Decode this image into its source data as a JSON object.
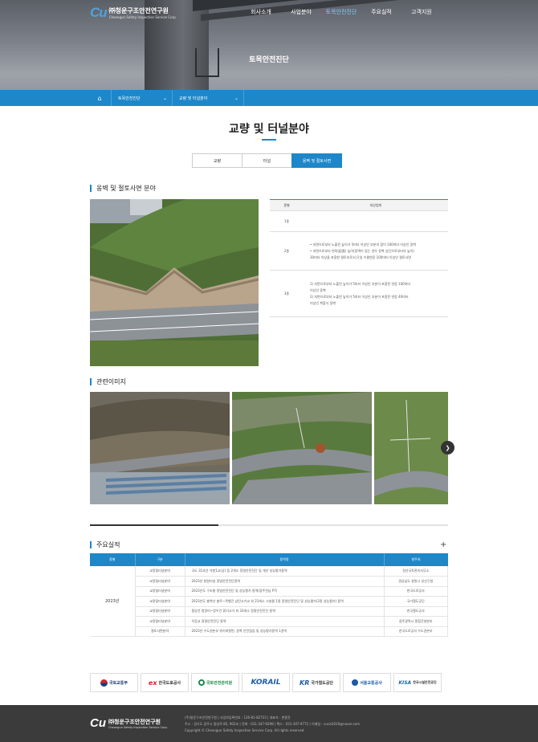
{
  "header": {
    "logo_mark": "Cu",
    "logo_name": "㈜청운구조안전연구원",
    "logo_eng": "Cheongun Safety Inspection Service Corp.",
    "nav": [
      "회사소개",
      "사업분야",
      "토목안전진단",
      "주요실적",
      "고객지원"
    ],
    "active_nav": 2
  },
  "hero": {
    "title": "토목안전진단"
  },
  "breadcrumb": {
    "level1": "토목안전진단",
    "level2": "교량 및 터널분야"
  },
  "page_title": "교량 및 터널분야",
  "tabs": [
    {
      "label": "교량",
      "active": false
    },
    {
      "label": "터널",
      "active": false
    },
    {
      "label": "옹벽 및 절토사면",
      "active": true
    }
  ],
  "section1": {
    "heading": "옹벽 및 절토사면 분야",
    "table": {
      "headers": [
        "종별",
        "대상범위"
      ],
      "rows": [
        {
          "grade": "1종",
          "lines": []
        },
        {
          "grade": "2종",
          "lines": [
            "• 지면으로부터 노출된 높이가 5미터 이상인 부분의 합이 100미터 이상인 옹벽",
            "• 지면으로부터 연직(鉛直) 높이(옹벽이 있는 경우 옹벽 상단으로부터의 높이)",
            "  30미터 이상을 포함한 절토부로서 단일 수평연장 100미터 이상인 절토사면"
          ]
        },
        {
          "grade": "3종",
          "lines": [
            "1) 지면으로부터 노출된 높이가 5미터 이상인 부분이 포함된 연장 100미터",
            "   이상인 옹벽",
            "2) 지면으로부터 노출된 높이가 5미터 이상인 부분이 포함된 연장 40미터",
            "   이상인 복합식 옹벽"
          ]
        }
      ]
    }
  },
  "section2": {
    "heading": "관련이미지"
  },
  "section3": {
    "heading": "주요실적",
    "plus": "+",
    "headers": [
      "종별",
      "구분",
      "용역명",
      "발주처"
    ],
    "year": "2023년",
    "rows": [
      {
        "type": "교량및터널분야",
        "name": "국도 31호선 석항1교(상) 등 2개소 정밀안전진단 및 개선 성능평가용역",
        "client": "정선국토관리사무소"
      },
      {
        "type": "교량및터널분야",
        "name": "2023년 창원터널 정밀안전진단용역",
        "client": "경상남도 창원시 성산구청"
      },
      {
        "type": "교량및터널분야",
        "name": "2023년도 구조물 정밀안전진단 및 성능평가 용역(광주전남 P7)",
        "client": "한국도로공사"
      },
      {
        "type": "교량및터널분야",
        "name": "2023년도 충북선 충주~목행간 삼탄고가교 외 23개소 시설물 1종 정밀안전진단 및 성능평가(2종 성능평가) 용역",
        "client": "국가철도공단"
      },
      {
        "type": "교량및터널분야",
        "name": "중앙선 청량리~망우간 휘기고가 외 33개소 정밀안전진단 용역",
        "client": "한국철도공사"
      },
      {
        "type": "교량및터널분야",
        "name": "우음교 정밀안전진단 용역",
        "client": "광주광역시 종합건설본부"
      },
      {
        "type": "절토사면분야",
        "name": "2023년 수도권본부 위기비탈면, 옹벽 안전점검 및 성능평가용역 1권역",
        "client": "한국도로공사 수도권본부"
      }
    ]
  },
  "partners": [
    {
      "label": "국토교통부",
      "color": "#1a3d7c",
      "icon": "taegeuk-icon"
    },
    {
      "label": "한국도로공사",
      "color": "#d4252a",
      "icon": "ex-logo-icon"
    },
    {
      "label": "국토안전관리원",
      "color": "#1a8a4a",
      "icon": "kalis-icon"
    },
    {
      "label": "KORAIL",
      "color": "#1d5ca8",
      "icon": "korail-icon"
    },
    {
      "label": "국가철도공단",
      "color": "#1d5ca8",
      "icon": "kr-icon"
    },
    {
      "label": "서울교통공사",
      "color": "#1a5aa6",
      "icon": "seoul-metro-icon"
    },
    {
      "label": "한국시설안전공단",
      "color": "#1a6aa6",
      "icon": "kistec-icon"
    }
  ],
  "footer": {
    "line1": "(주)청운구조안전연구원 | 사업자등록번호 : 126-81-82723 | 대표자 : 변종윤",
    "line2": "주소 : 경기도 광주시 중앙로 85, 902호 | 전화 : 031-347-9298 | 팩스 : 031-347-9772 | 이메일 : cusis2019@naver.com",
    "copyright": "Copyright © Cheongun Safety Inspection Service Corp. All rights reserved."
  },
  "colors": {
    "accent": "#1d87c9",
    "footer": "#3b3b3b"
  }
}
